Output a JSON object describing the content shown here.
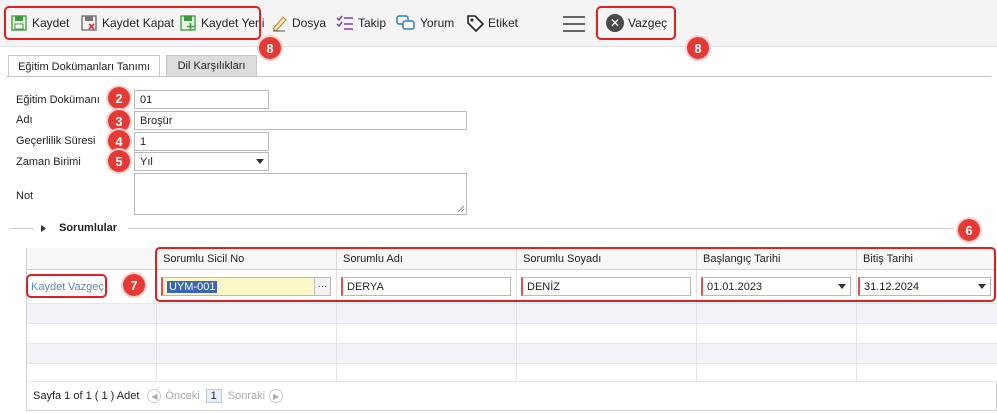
{
  "toolbar": {
    "save": "Kaydet",
    "save_close": "Kaydet Kapat",
    "save_new": "Kaydet Yeni",
    "file": "Dosya",
    "follow": "Takip",
    "comment": "Yorum",
    "tag": "Etiket",
    "cancel": "Vazgeç"
  },
  "tabs": [
    "Eğitim Dokümanları Tanımı",
    "Dil Karşılıkları"
  ],
  "form": {
    "doc_label": "Eğitim Dokümanı",
    "doc_value": "01",
    "name_label": "Adı",
    "name_value": "Broşür",
    "validity_label": "Geçerlilik Süresi",
    "validity_value": "1",
    "time_unit_label": "Zaman Birimi",
    "time_unit_value": "Yıl",
    "note_label": "Not",
    "note_value": ""
  },
  "section": {
    "title": "Sorumlular"
  },
  "grid": {
    "columns": [
      "Sorumlu Sicil No",
      "Sorumlu Adı",
      "Sorumlu Soyadı",
      "Başlangıç Tarihi",
      "Bitiş Tarihi"
    ],
    "row_actions": {
      "save": "Kaydet",
      "cancel": "Vazgeç"
    },
    "edit_row": {
      "sicil_no": "UYM-001",
      "ad": "DERYA",
      "soyad": "DENİZ",
      "baslangic": "01.01.2023",
      "bitis": "31.12.2024"
    }
  },
  "pager": {
    "summary": "Sayfa 1 of 1 ( 1 ) Adet",
    "prev": "Önceki",
    "page": "1",
    "next": "Sonraki"
  },
  "annotations": [
    "8",
    "8",
    "2",
    "3",
    "4",
    "5",
    "6",
    "7"
  ],
  "colors": {
    "annotation_red": "#e53935",
    "accent_blue": "#2f7fc9",
    "purple": "#7b3fb8"
  }
}
